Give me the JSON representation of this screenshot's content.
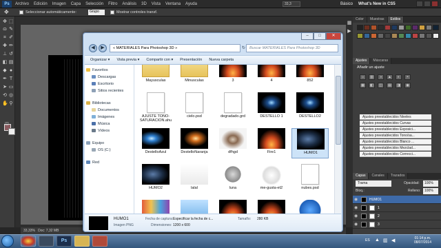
{
  "photoshop": {
    "logo": "Ps",
    "menu": [
      "Archivo",
      "Edición",
      "Imagen",
      "Capa",
      "Selección",
      "Filtro",
      "Análisis",
      "3D",
      "Vista",
      "Ventana",
      "Ayuda"
    ],
    "zoom": "33,3",
    "workspace": "Básico",
    "whats_new": "What's New in CS5",
    "options": {
      "auto_select": "Seleccionar automáticamente:",
      "group_value": "Grupo",
      "show_controls": "Mostrar controles transf."
    },
    "status": "33,33%",
    "doc_info": "Doc: 7,32 MB"
  },
  "right_panels": {
    "top_tabs": [
      "Color",
      "Muestras",
      "Estilos"
    ],
    "adj_tabs": [
      "Ajustes",
      "Máscaras"
    ],
    "adj_title": "Añadir un ajuste",
    "presets": [
      "Ajustes preestablecidos Niveles",
      "Ajustes preestablecidos Curvas",
      "Ajustes preestablecidos Exposici...",
      "Ajustes preestablecidos Tono/sa...",
      "Ajustes preestablecidos Blanco ...",
      "Ajustes preestablecidos Mezclad...",
      "Ajustes preestablecidos Correcci..."
    ],
    "layer_tabs": [
      "Capas",
      "Canales",
      "Trazados"
    ],
    "blend_mode": "Trama",
    "opacity_label": "Opacidad:",
    "opacity_value": "100%",
    "lock_label": "Bloq.:",
    "fill_label": "Relleno:",
    "fill_value": "100%",
    "layers": [
      "HUMO1",
      "1",
      "2",
      "3"
    ]
  },
  "explorer": {
    "path": "« MATERIALES Para Photoshop 3D »",
    "search_placeholder": "Buscar MATERIALES Para Photoshop 3D",
    "toolbar": [
      "Organizar ▾",
      "Vista previa ▾",
      "Compartir con ▾",
      "Presentación",
      "Nueva carpeta"
    ],
    "nav": {
      "favorites": "Favoritos",
      "fav_items": [
        "Descargas",
        "Escritorio",
        "Sitios recientes"
      ],
      "libraries": "Bibliotecas",
      "lib_items": [
        "Documentos",
        "Imágenes",
        "Música",
        "Vídeos"
      ],
      "computer": "Equipo",
      "computer_items": [
        "OS (C:)"
      ],
      "network": "Red"
    },
    "files": [
      {
        "label": "Mayusculas",
        "kind": "folder"
      },
      {
        "label": "Minusculas",
        "kind": "folder"
      },
      {
        "label": "3",
        "kind": "fire"
      },
      {
        "label": "4",
        "kind": "fire"
      },
      {
        "label": "852",
        "kind": "fire"
      },
      {
        "label": "AJUSTE TONO-SATURACION.ahu",
        "kind": "doc"
      },
      {
        "label": "cielo.psd",
        "kind": "doc"
      },
      {
        "label": "degradado.grd",
        "kind": "doc"
      },
      {
        "label": "DESTELLO 1",
        "kind": "glow"
      },
      {
        "label": "DESTELLO2",
        "kind": "glow"
      },
      {
        "label": "DestelloAzul",
        "kind": "blue"
      },
      {
        "label": "DestelloNaranja",
        "kind": "orange"
      },
      {
        "label": "dfhgd",
        "kind": "eagle"
      },
      {
        "label": "Fire1",
        "kind": "fire"
      },
      {
        "label": "HUMO1",
        "kind": "smoke"
      },
      {
        "label": "HUMO2",
        "kind": "smoke"
      },
      {
        "label": "lalal",
        "kind": "tutorial"
      },
      {
        "label": "luna",
        "kind": "moon"
      },
      {
        "label": "me-gusta-et2",
        "kind": "meme"
      },
      {
        "label": "nubes.psd",
        "kind": "doc"
      },
      {
        "label": "",
        "kind": "colorful"
      },
      {
        "label": "",
        "kind": "sky"
      },
      {
        "label": "",
        "kind": "fire"
      },
      {
        "label": "",
        "kind": "fire"
      },
      {
        "label": "",
        "kind": "logo3d"
      }
    ],
    "details": {
      "name": "HUMO1",
      "type": "Imagen PNG",
      "date_label": "Fecha de captura:",
      "date_value": "Especificar la fecha de c...",
      "dims_label": "Dimensiones:",
      "dims_value": "1200 x 600",
      "size_label": "Tamaño:",
      "size_value": "280 KB"
    }
  },
  "taskbar": {
    "apps": [
      "",
      "",
      "Ps",
      "",
      ""
    ],
    "lang": "ES",
    "time": "01:14 p.m.",
    "date": "08/07/2014"
  }
}
